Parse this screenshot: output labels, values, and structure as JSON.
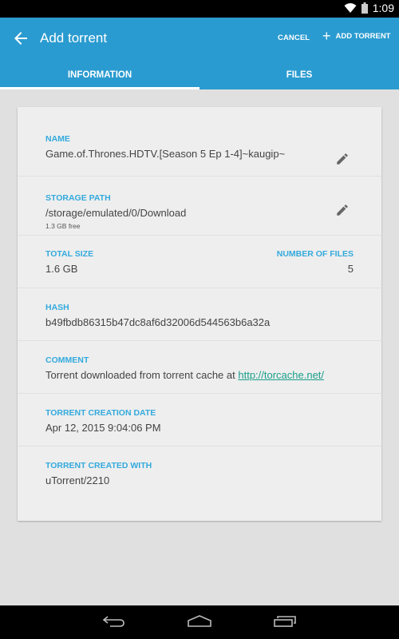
{
  "status_bar": {
    "time": "1:09",
    "icons": [
      "wifi-icon",
      "battery-icon"
    ]
  },
  "app_bar": {
    "title": "Add torrent",
    "back_icon": "arrow-left-icon",
    "cancel_label": "CANCEL",
    "add_label": "ADD TORRENT",
    "add_icon": "plus-icon",
    "color": "#2a9bd0"
  },
  "tabs": [
    {
      "label": "INFORMATION",
      "active": true
    },
    {
      "label": "FILES",
      "active": false
    }
  ],
  "info": {
    "name": {
      "label": "NAME",
      "value": "Game.of.Thrones.HDTV.[Season 5 Ep 1-4]~kaugip~",
      "icon": "pencil-icon"
    },
    "storage": {
      "label": "STORAGE PATH",
      "value": "/storage/emulated/0/Download",
      "sub": "1.3 GB free",
      "icon": "pencil-icon"
    },
    "total_size": {
      "label": "TOTAL SIZE",
      "value": "1.6 GB"
    },
    "num_files": {
      "label": "NUMBER OF FILES",
      "value": "5"
    },
    "hash": {
      "label": "HASH",
      "value": "b49fbdb86315b47dc8af6d32006d544563b6a32a"
    },
    "comment": {
      "label": "COMMENT",
      "text": "Torrent downloaded from torrent cache at ",
      "link": "http://torcache.net/"
    },
    "creation_date": {
      "label": "TORRENT CREATION DATE",
      "value": "Apr 12, 2015 9:04:06 PM"
    },
    "created_with": {
      "label": "TORRENT CREATED WITH",
      "value": "uTorrent/2210"
    }
  },
  "nav_bar": {
    "buttons": [
      "back-nav-icon",
      "home-icon",
      "recents-icon"
    ]
  },
  "colors": {
    "accent_label": "#33aadd",
    "link": "#1a9e8a"
  }
}
